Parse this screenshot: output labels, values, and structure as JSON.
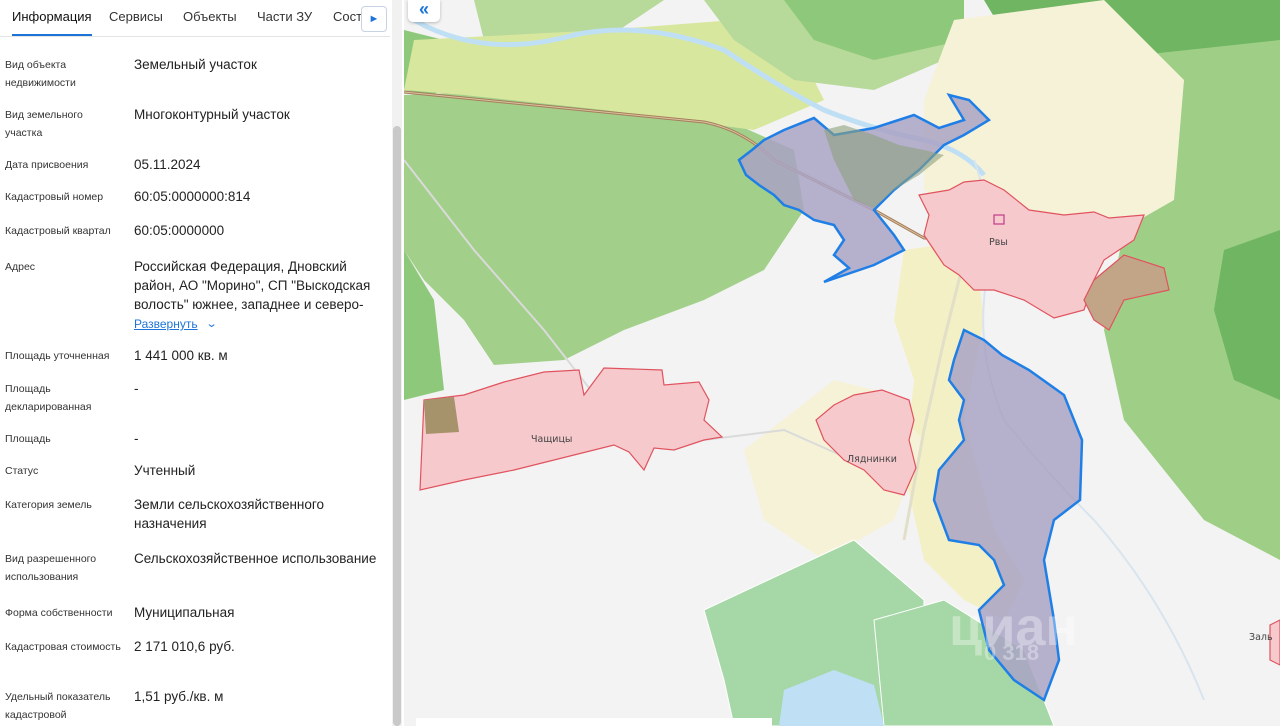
{
  "tabs": [
    {
      "label": "Информация",
      "active": true
    },
    {
      "label": "Сервисы",
      "active": false
    },
    {
      "label": "Объекты",
      "active": false
    },
    {
      "label": "Части ЗУ",
      "active": false
    },
    {
      "label": "Состав",
      "active": false
    }
  ],
  "tabs_next_icon": "chevron-right-icon",
  "properties": [
    {
      "label": "Вид объекта недвижимости",
      "value": "Земельный участок"
    },
    {
      "label": "Вид земельного участка",
      "value": "Многоконтурный участок"
    },
    {
      "label": "Дата присвоения",
      "value": "05.11.2024"
    },
    {
      "label": "Кадастровый номер",
      "value": "60:05:0000000:814"
    },
    {
      "label": "Кадастровый квартал",
      "value": "60:05:0000000"
    },
    {
      "label": "Адрес",
      "value": "Российская Федерация, Дновский район, АО \"Морино\", СП \"Выскодская волость\" южнее, западнее и северо-"
    },
    {
      "label": "Площадь уточненная",
      "value": "1 441 000 кв. м"
    },
    {
      "label": "Площадь декларированная",
      "value": "-"
    },
    {
      "label": "Площадь",
      "value": "-"
    },
    {
      "label": "Статус",
      "value": "Учтенный"
    },
    {
      "label": "Категория земель",
      "value": "Земли сельскохозяйственного назначения"
    },
    {
      "label": "Вид разрешенного использования",
      "value": "Сельскохозяйственное использование"
    },
    {
      "label": "Форма собственности",
      "value": "Муниципальная"
    },
    {
      "label": "Кадастровая стоимость",
      "value": "2 171 010,6 руб."
    },
    {
      "label": "Удельный показатель кадастровой",
      "value": "1,51 руб./кв. м"
    }
  ],
  "expand_label": "Развернуть",
  "map": {
    "collapse_icon": "double-chevron-left-icon",
    "places": [
      "Рвы",
      "Чащицы",
      "Ляднинки",
      "Заль"
    ],
    "watermark": "циан",
    "watermark_phone": "0 318",
    "colors": {
      "parcel_fill": "#a9a3c4",
      "parcel_stroke": "#1f7fe6",
      "settlement_fill": "#f6c9cd",
      "settlement_stroke": "#e0535e",
      "forest_light": "#b7d99a",
      "forest": "#8ec87a",
      "forest_dark": "#6fb562",
      "farmland": "#f6f2d8",
      "yellow_zone": "#f4f0c6",
      "water": "#bfdff5",
      "meadow": "#a6d7a6"
    }
  }
}
